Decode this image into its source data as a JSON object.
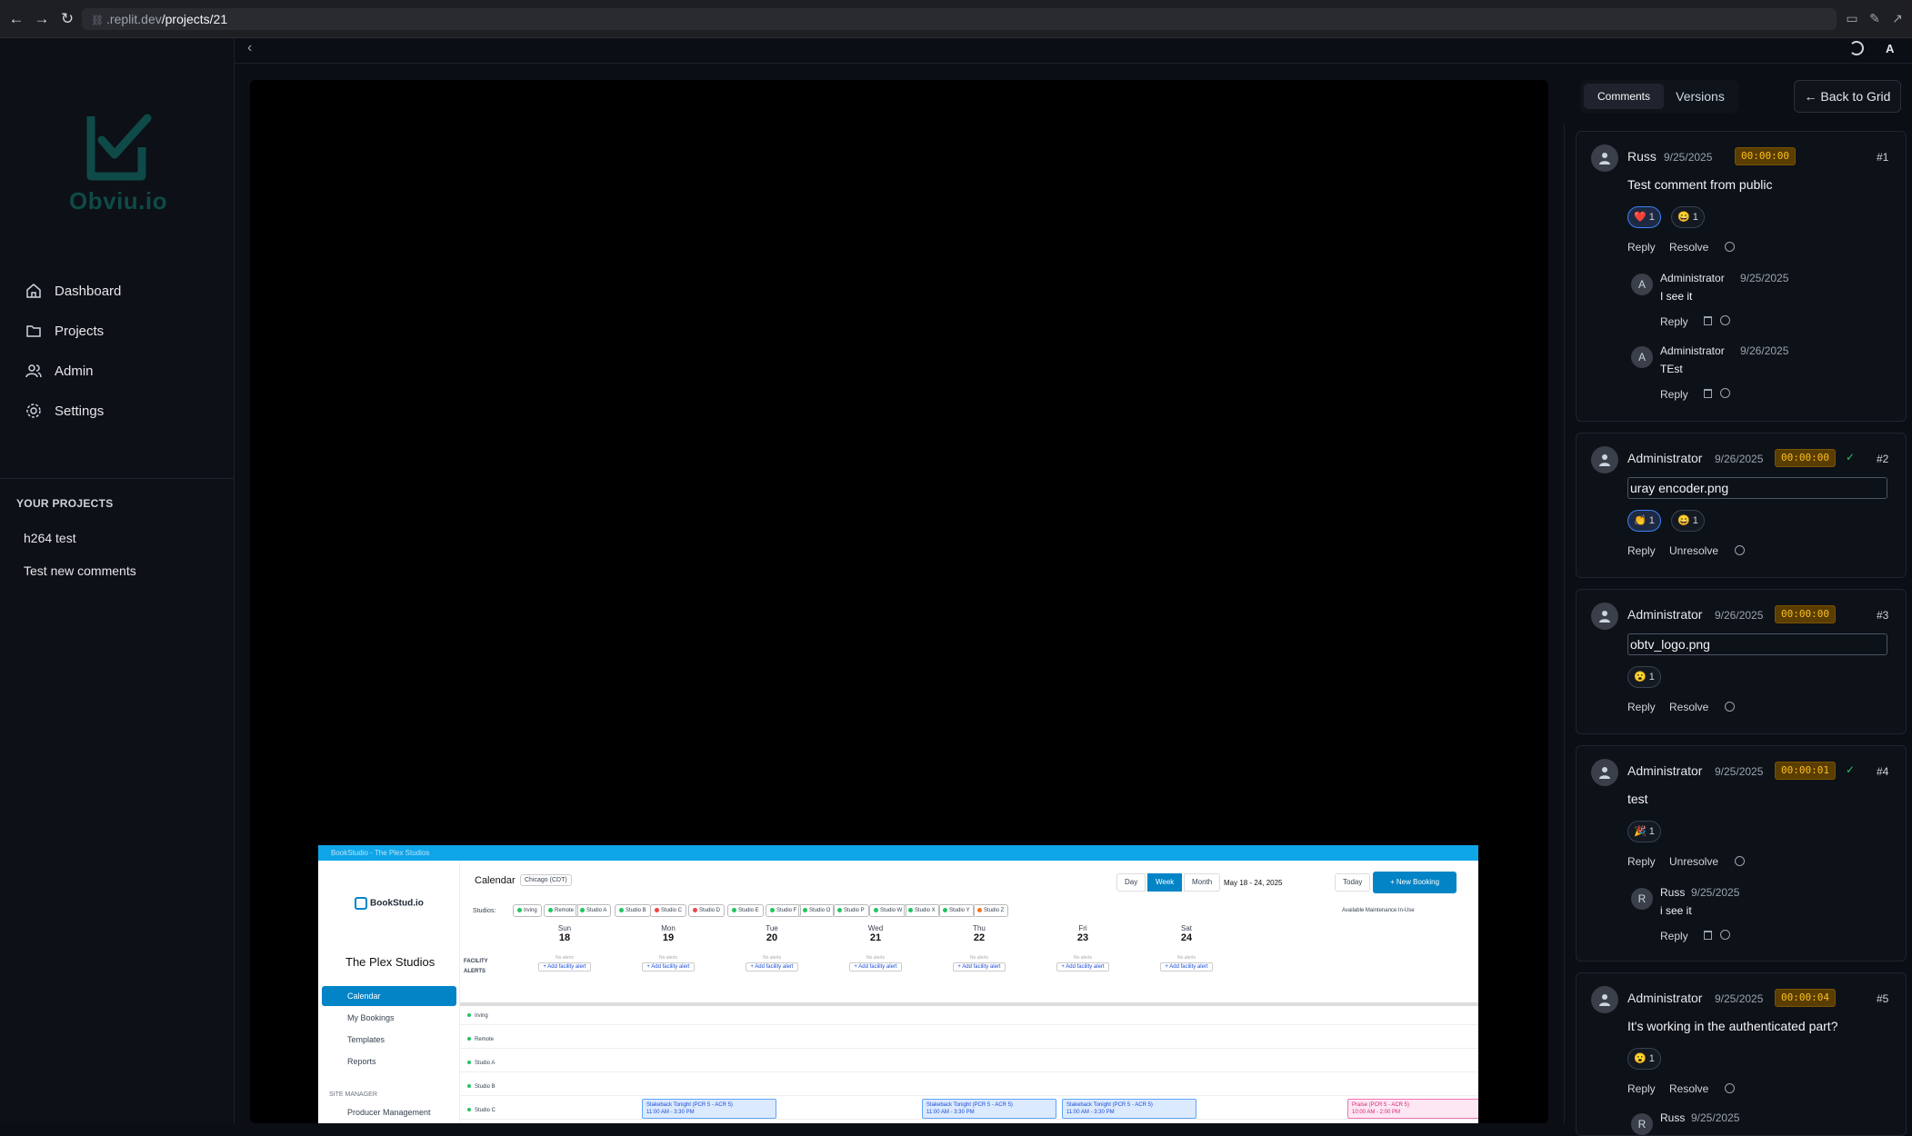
{
  "browser": {
    "url_domain": ".replit.dev",
    "url_path": "/projects/21"
  },
  "sidebar": {
    "logo_text": "Obviu.io",
    "items": [
      {
        "label": "Dashboard",
        "icon": "home-icon"
      },
      {
        "label": "Projects",
        "icon": "folder-icon"
      },
      {
        "label": "Admin",
        "icon": "users-icon"
      },
      {
        "label": "Settings",
        "icon": "gear-icon"
      }
    ],
    "projects_title": "YOUR PROJECTS",
    "projects": [
      "h264 test",
      "Test new comments"
    ]
  },
  "topbar": {
    "collapse_icon": "chevron-left-icon",
    "theme_icon": "moon-icon",
    "user_initial": "A"
  },
  "embed": {
    "window_title": "BookStudio - The Plex Studios",
    "app_name": "BookStud.io",
    "org_name": "The Plex Studios",
    "nav": [
      "Calendar",
      "My Bookings",
      "Templates",
      "Reports"
    ],
    "section": "SITE MANAGER",
    "section_item": "Producer Management",
    "title": "Calendar",
    "timezone": "Chicago (CDT)",
    "views": [
      "Day",
      "Week",
      "Month"
    ],
    "range": "May 18 - 24, 2025",
    "today": "Today",
    "new_booking": "+ New Booking",
    "studios_label": "Studios:",
    "studios": [
      "Irving",
      "Remote",
      "Studio A",
      "Studio B",
      "Studio C",
      "Studio D",
      "Studio E",
      "Studio F",
      "Studio O",
      "Studio P",
      "Studio W",
      "Studio X",
      "Studio Y",
      "Studio Z"
    ],
    "legend": "Available  Maintenance  In-Use",
    "days": [
      {
        "name": "Sun",
        "date": "18"
      },
      {
        "name": "Mon",
        "date": "19"
      },
      {
        "name": "Tue",
        "date": "20"
      },
      {
        "name": "Wed",
        "date": "21"
      },
      {
        "name": "Thu",
        "date": "22"
      },
      {
        "name": "Fri",
        "date": "23"
      },
      {
        "name": "Sat",
        "date": "24"
      }
    ],
    "facility_label": "FACILITY ALERTS",
    "no_alerts": "No alerts",
    "add_alert": "+ Add facility alert",
    "rows": [
      "Irving",
      "Remote",
      "Studio A",
      "Studio B",
      "Studio C"
    ],
    "bookings": [
      {
        "title": "Stakeback Tonight (PCR 5 - ACR 5)",
        "time": "11:00 AM - 3:30 PM"
      },
      {
        "title": "Stakeback Tonight (PCR 5 - ACR 5)",
        "time": "11:00 AM - 3:30 PM"
      },
      {
        "title": "Stakeback Tonight (PCR 5 - ACR 5)",
        "time": "11:00 AM - 3:30 PM"
      },
      {
        "title": "Praise (PCR 5 - ACR 5)",
        "time": "10:00 AM - 2:00 PM"
      }
    ]
  },
  "panel": {
    "tabs": [
      "Comments",
      "Versions"
    ],
    "back_button": "← Back to Grid",
    "reply": "Reply",
    "resolve": "Resolve",
    "unresolve": "Unresolve",
    "comments": [
      {
        "author": "Russ",
        "date": "9/25/2025",
        "timestamp": "00:00:00",
        "number": "#1",
        "text": "Test comment from public",
        "reactions": [
          {
            "emoji": "❤️",
            "count": "1"
          },
          {
            "emoji": "😄",
            "count": "1"
          }
        ],
        "action": "Resolve",
        "replies": [
          {
            "initial": "A",
            "author": "Administrator",
            "date": "9/25/2025",
            "text": "I see it"
          },
          {
            "initial": "A",
            "author": "Administrator",
            "date": "9/26/2025",
            "text": "TEst"
          }
        ]
      },
      {
        "author": "Administrator",
        "date": "9/26/2025",
        "timestamp": "00:00:00",
        "number": "#2",
        "text": "uray encoder.png",
        "reactions": [
          {
            "emoji": "👏",
            "count": "1"
          },
          {
            "emoji": "😄",
            "count": "1"
          }
        ],
        "action": "Unresolve"
      },
      {
        "author": "Administrator",
        "date": "9/26/2025",
        "timestamp": "00:00:00",
        "number": "#3",
        "text": "obtv_logo.png",
        "reactions": [
          {
            "emoji": "😮",
            "count": "1"
          }
        ],
        "action": "Resolve"
      },
      {
        "author": "Administrator",
        "date": "9/25/2025",
        "timestamp": "00:00:01",
        "number": "#4",
        "text": "test",
        "reactions": [
          {
            "emoji": "🎉",
            "count": "1"
          }
        ],
        "action": "Unresolve",
        "replies": [
          {
            "initial": "R",
            "author": "Russ",
            "date": "9/25/2025",
            "text": "i see it"
          }
        ]
      },
      {
        "author": "Administrator",
        "date": "9/25/2025",
        "timestamp": "00:00:04",
        "number": "#5",
        "text": "It's working in the authenticated part?",
        "reactions": [
          {
            "emoji": "😮",
            "count": "1"
          }
        ],
        "action": "Resolve",
        "replies": [
          {
            "initial": "R",
            "author": "Russ",
            "date": "9/25/2025",
            "text": ""
          }
        ]
      }
    ]
  },
  "colors": {
    "accent": "#0284c7",
    "timestamp_bg": "#5a3d00",
    "timestamp_text": "#fbbf24",
    "resolved_check": "#22c55e",
    "logo": "#0e4a48"
  }
}
